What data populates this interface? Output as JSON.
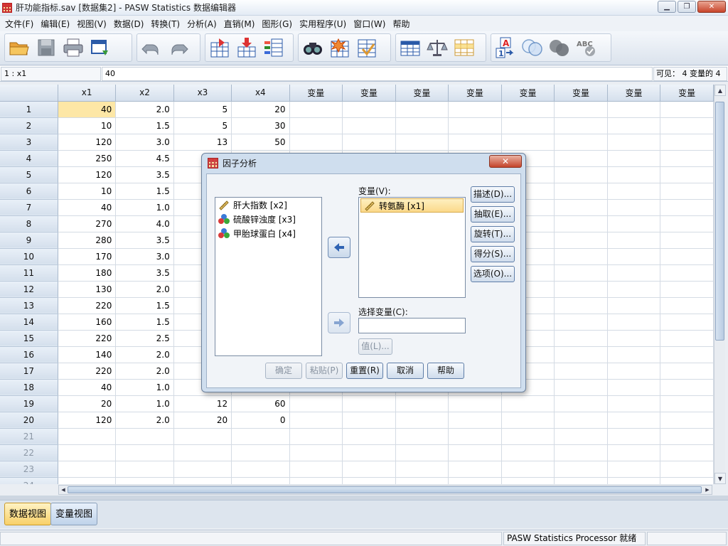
{
  "window": {
    "title": "肝功能指标.sav [数据集2] - PASW Statistics 数据编辑器"
  },
  "menu": [
    "文件(F)",
    "编辑(E)",
    "视图(V)",
    "数据(D)",
    "转换(T)",
    "分析(A)",
    "直销(M)",
    "图形(G)",
    "实用程序(U)",
    "窗口(W)",
    "帮助"
  ],
  "toolbar": {
    "icons": [
      "open-file-icon",
      "save-icon",
      "print-icon",
      "dialog-recall-icon",
      "undo-icon",
      "redo-icon",
      "goto-case-icon",
      "goto-variable-icon",
      "variables-icon",
      "find-icon",
      "insert-cases-icon",
      "insert-variable-icon",
      "split-file-icon",
      "weight-cases-icon",
      "select-cases-icon",
      "value-labels-icon",
      "use-sets-icon",
      "show-all-variables-icon",
      "spell-check-icon"
    ]
  },
  "refbar": {
    "cell_ref": "1 : x1",
    "cell_value": "40",
    "visible": "可见： 4 变量的 4"
  },
  "grid": {
    "columns": [
      "x1",
      "x2",
      "x3",
      "x4",
      "变量",
      "变量",
      "变量",
      "变量",
      "变量",
      "变量",
      "变量",
      "变量"
    ],
    "rows": [
      [
        "40",
        "2.0",
        "5",
        "20"
      ],
      [
        "10",
        "1.5",
        "5",
        "30"
      ],
      [
        "120",
        "3.0",
        "13",
        "50"
      ],
      [
        "250",
        "4.5",
        "",
        ""
      ],
      [
        "120",
        "3.5",
        "",
        ""
      ],
      [
        "10",
        "1.5",
        "",
        ""
      ],
      [
        "40",
        "1.0",
        "",
        ""
      ],
      [
        "270",
        "4.0",
        "",
        ""
      ],
      [
        "280",
        "3.5",
        "",
        ""
      ],
      [
        "170",
        "3.0",
        "",
        ""
      ],
      [
        "180",
        "3.5",
        "",
        ""
      ],
      [
        "130",
        "2.0",
        "",
        ""
      ],
      [
        "220",
        "1.5",
        "",
        ""
      ],
      [
        "160",
        "1.5",
        "",
        ""
      ],
      [
        "220",
        "2.5",
        "",
        ""
      ],
      [
        "140",
        "2.0",
        "",
        ""
      ],
      [
        "220",
        "2.0",
        "",
        ""
      ],
      [
        "40",
        "1.0",
        "",
        ""
      ],
      [
        "20",
        "1.0",
        "12",
        "60"
      ],
      [
        "120",
        "2.0",
        "20",
        "0"
      ]
    ],
    "empty_rows": [
      "21",
      "22",
      "23",
      "24"
    ]
  },
  "view_tabs": {
    "data_view": "数据视图",
    "variable_view": "变量视图"
  },
  "status": {
    "processor": "PASW Statistics Processor 就绪"
  },
  "dialog": {
    "title": "因子分析",
    "close": "✕",
    "source_list": [
      {
        "label": "肝大指数 [x2]",
        "icon": "scale-ruler-icon"
      },
      {
        "label": "硫酸锌浊度 [x3]",
        "icon": "nominal-balls-icon"
      },
      {
        "label": "甲胎球蛋白 [x4]",
        "icon": "nominal-balls-icon"
      }
    ],
    "variables_label": "变量(V):",
    "variables_list": [
      {
        "label": "转氨酶 [x1]",
        "icon": "scale-ruler-icon"
      }
    ],
    "selection_label": "选择变量(C):",
    "selection_value": "",
    "value_button": "值(L)...",
    "side_buttons": [
      "描述(D)...",
      "抽取(E)...",
      "旋转(T)...",
      "得分(S)...",
      "选项(O)..."
    ],
    "bottom_buttons": {
      "ok": "确定",
      "paste": "粘贴(P)",
      "reset": "重置(R)",
      "cancel": "取消",
      "help": "帮助"
    }
  }
}
